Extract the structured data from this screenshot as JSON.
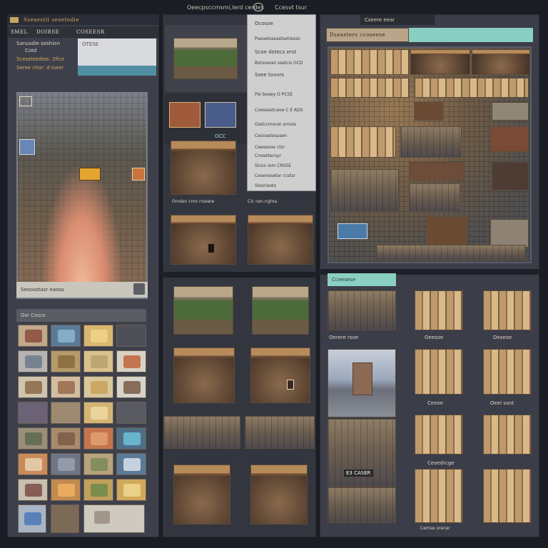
{
  "window": {
    "title": "Oeecpsccmsmi,lerd cerdes",
    "title_right": "Ccesvt tsur"
  },
  "left_panel": {
    "header_title": "Sseaestit seoetedie",
    "tab_left": "SMEL",
    "tab_mid": "DOIRSE",
    "tab_right": "COSEESR",
    "info_line1": "Sanusdie seshion",
    "info_line2": "Cotd",
    "info_line3": "Sceseleedies: 2fice",
    "info_line4": "Seree chor: d tsesr",
    "search_text": "OTESE",
    "map_footer": "Seoosstasr eaoss",
    "inventory_title": "Osr Coscs"
  },
  "middle_panel": {
    "thumb_badge": "OCC",
    "row_caption": "Onolen cmo rrseare",
    "row_caption_right": "Cic cen.ngtoa"
  },
  "dropdown_menu": {
    "items": [
      "Ocosoe",
      "Pseoetsseastsetiesso",
      "Scoe dotecs erst",
      "Bstoseoet ssetcis  OCD",
      "Ssee tovors",
      "Pie beaey  O PCSE",
      "Coesesstceoe   C E ADS",
      "Oadccmocer  ernsie",
      "Cesnsetesasen",
      "Ceesesoe  ctsr",
      "Cnosetecsyr",
      "Slcos rem  CRSSE",
      "Cesenesetor  ccstsr",
      "Stesrisoto"
    ]
  },
  "right_panel": {
    "top_tab": "Cseere eear",
    "top_title": "Dseasters ccoseese",
    "section_tab": "Cceesese",
    "caption_a": "Oerere rsoe",
    "caption_b": "Oeesoe",
    "caption_c": "Deseoe",
    "caption_d": "Ceeoe",
    "caption_e": "Oeei sant",
    "caption_f": "Ceoedrcge",
    "marker": "E3 CASER",
    "footer": "Cemse orecer"
  }
}
